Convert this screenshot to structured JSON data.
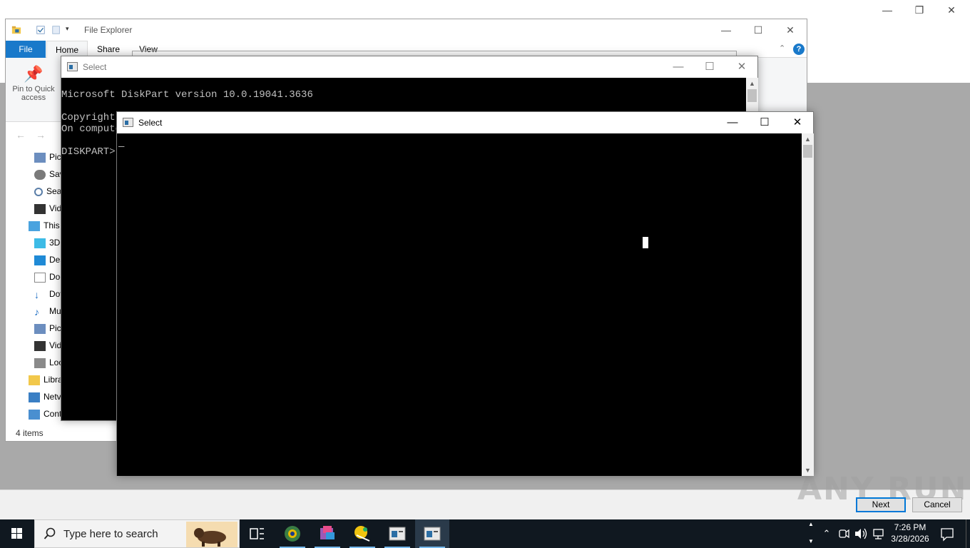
{
  "installer": {
    "next_label": "Next",
    "cancel_label": "Cancel",
    "watermark": "ANY RUN"
  },
  "explorer": {
    "title": "File Explorer",
    "tabs": {
      "file": "File",
      "home": "Home",
      "share": "Share",
      "view": "View"
    },
    "pin_label_1": "Pin to Quick",
    "pin_label_2": "access",
    "nav_items": [
      "Pic",
      "Sav",
      "Sea",
      "Vid",
      "This",
      "3D",
      "Des",
      "Doc",
      "Dov",
      "Mu",
      "Pic",
      "Vid",
      "Loc",
      "Libra",
      "Netv",
      "Cont"
    ],
    "status": "4 items"
  },
  "console_back": {
    "title": "Select",
    "lines": [
      "Microsoft DiskPart version 10.0.19041.3636",
      "",
      "Copyright",
      "On compute",
      "",
      "DISKPART>"
    ]
  },
  "console_front": {
    "title": "Select",
    "cursor": "_"
  },
  "taskbar": {
    "search_placeholder": "Type here to search",
    "time": "7:26 PM",
    "date": "3/28/2026"
  },
  "colors": {
    "accent": "#0078d7",
    "file_tab": "#1979ca",
    "taskbar": "#101820"
  }
}
